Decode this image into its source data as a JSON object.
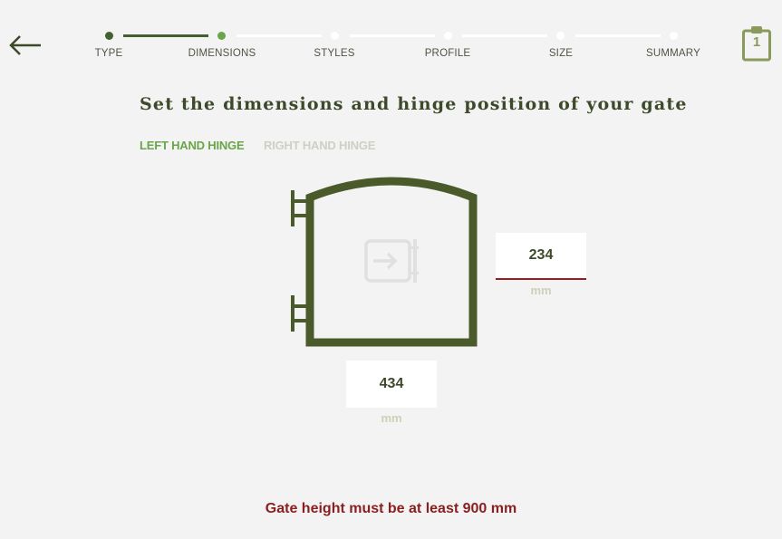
{
  "stepper": {
    "steps": [
      {
        "label": "TYPE",
        "state": "done"
      },
      {
        "label": "DIMENSIONS",
        "state": "current"
      },
      {
        "label": "STYLES",
        "state": "todo"
      },
      {
        "label": "PROFILE",
        "state": "todo"
      },
      {
        "label": "SIZE",
        "state": "todo"
      },
      {
        "label": "SUMMARY",
        "state": "todo"
      }
    ]
  },
  "cart": {
    "count": "1",
    "icon": "clipboard-icon"
  },
  "nav": {
    "back_icon": "arrow-left-icon"
  },
  "page": {
    "title": "Set the dimensions and hinge position of your gate"
  },
  "hinge": {
    "left_label": "LEFT HAND HINGE",
    "right_label": "RIGHT HAND HINGE",
    "selected": "left"
  },
  "dimensions": {
    "width_value": "234",
    "width_unit": "mm",
    "height_value": "434",
    "height_unit": "mm"
  },
  "error": {
    "message": "Gate height must be at least 900 mm"
  },
  "colors": {
    "primary": "#45602f",
    "accent": "#6aa54a",
    "error": "#8a1f1f",
    "gate": "#4a5a2a"
  }
}
